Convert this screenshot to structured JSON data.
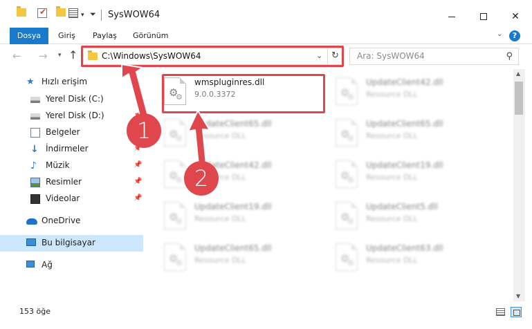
{
  "window": {
    "title": "SysWOW64",
    "minimize_glyph": "",
    "close_glyph": "✕"
  },
  "ribbon": {
    "tabs": [
      "Dosya",
      "Giriş",
      "Paylaş",
      "Görünüm"
    ]
  },
  "address": {
    "path": "C:\\Windows\\SysWOW64",
    "refresh_glyph": "↻"
  },
  "search": {
    "placeholder": "Ara: SysWOW64"
  },
  "sidebar": {
    "items": [
      {
        "label": "Hızlı erişim",
        "icon": "star-icon"
      },
      {
        "label": "Yerel Disk (C:)",
        "icon": "disk-icon"
      },
      {
        "label": "Yerel Disk (D:)",
        "icon": "disk-icon"
      },
      {
        "label": "Belgeler",
        "icon": "documents-icon"
      },
      {
        "label": "İndirmeler",
        "icon": "downloads-icon"
      },
      {
        "label": "Müzik",
        "icon": "music-icon"
      },
      {
        "label": "Resimler",
        "icon": "pictures-icon"
      },
      {
        "label": "Videolar",
        "icon": "videos-icon"
      },
      {
        "label": "OneDrive",
        "icon": "onedrive-icon"
      },
      {
        "label": "Bu bilgisayar",
        "icon": "this-pc-icon"
      },
      {
        "label": "Ağ",
        "icon": "network-icon"
      }
    ]
  },
  "files": [
    {
      "name": "wmspluginres.dll",
      "sub": "9.0.0.3372"
    },
    {
      "name": "UpdateClient42.dll",
      "sub": "Resource DLL"
    },
    {
      "name": "UpdateClient65.dll",
      "sub": "Resource DLL"
    },
    {
      "name": "UpdateClient65.dll",
      "sub": "Resource DLL"
    },
    {
      "name": "UpdateClient42.dll",
      "sub": "Resource DLL"
    },
    {
      "name": "UpdateClient19.dll",
      "sub": "Resource DLL"
    },
    {
      "name": "UpdateClient19.dll",
      "sub": "Resource DLL"
    },
    {
      "name": "UpdateClient5.dll",
      "sub": "Resource DLL"
    },
    {
      "name": "UpdateClient65.dll",
      "sub": "Resource DLL"
    },
    {
      "name": "UpdateClient63.dll",
      "sub": "Resource DLL"
    }
  ],
  "status": {
    "item_count": "153 öğe"
  },
  "callouts": [
    "1",
    "2"
  ],
  "colors": {
    "accent": "#1979ca",
    "highlight": "#e0474c",
    "selected_nav": "#cce8ff"
  }
}
